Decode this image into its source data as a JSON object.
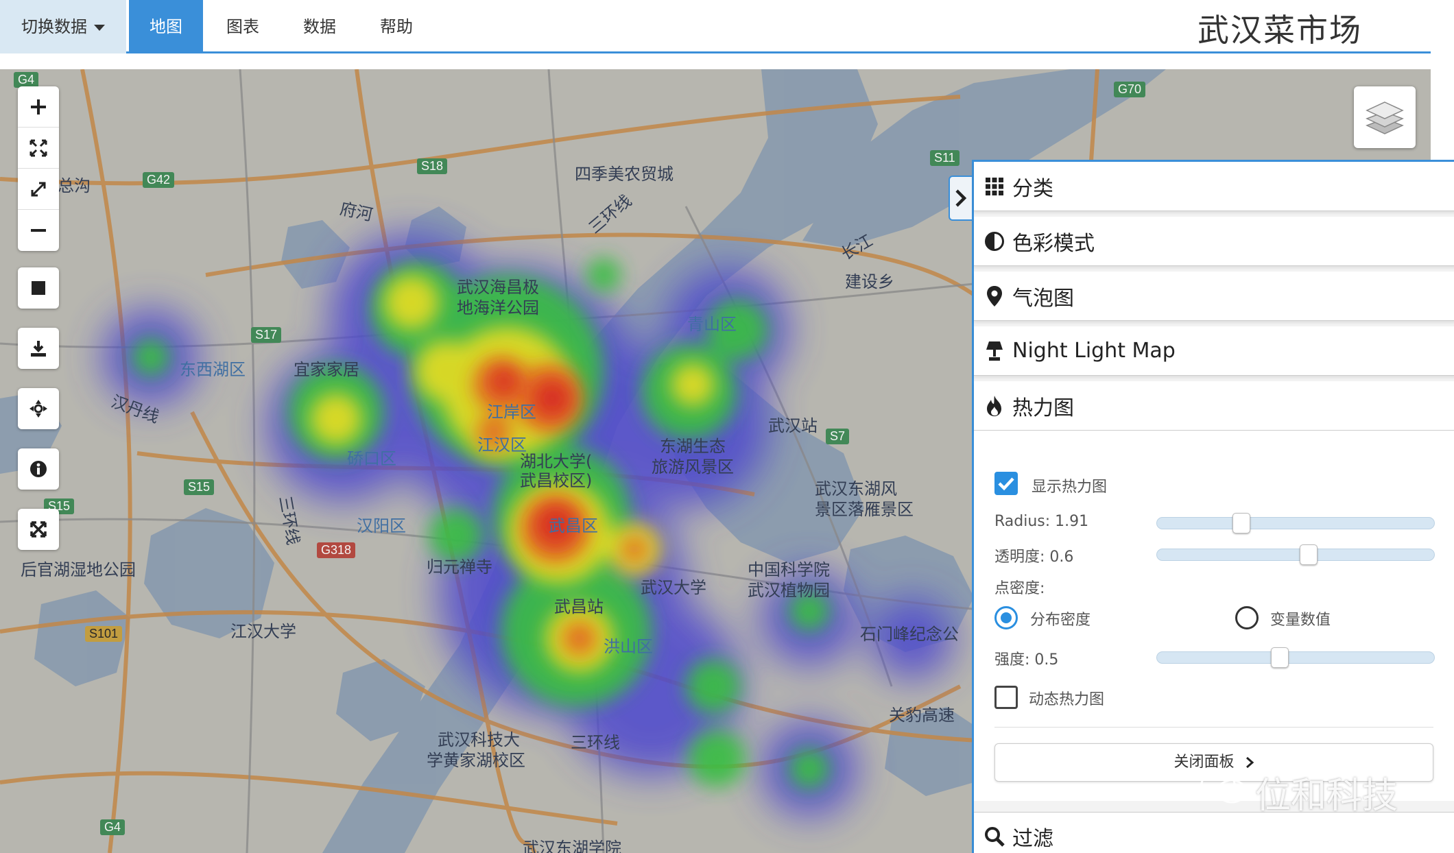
{
  "nav": {
    "switch_label": "切换数据",
    "tabs": [
      "地图",
      "图表",
      "数据",
      "帮助"
    ],
    "title": "武汉菜市场"
  },
  "map": {
    "labels": [
      {
        "text": "四季美农贸城",
        "blue": false
      },
      {
        "text": "武汉海昌极",
        "blue": false
      },
      {
        "text": "地海洋公园",
        "blue": false
      },
      {
        "text": "青山区",
        "blue": true
      },
      {
        "text": "东西湖区",
        "blue": true
      },
      {
        "text": "宜家家居",
        "blue": false
      },
      {
        "text": "硚口区",
        "blue": true
      },
      {
        "text": "江岸区",
        "blue": true
      },
      {
        "text": "江汉区",
        "blue": true
      },
      {
        "text": "湖北大学(",
        "blue": false
      },
      {
        "text": "武昌校区)",
        "blue": false
      },
      {
        "text": "东湖生态",
        "blue": false
      },
      {
        "text": "旅游风景区",
        "blue": false
      },
      {
        "text": "武汉站",
        "blue": false
      },
      {
        "text": "武汉东湖风",
        "blue": false
      },
      {
        "text": "景区落雁景区",
        "blue": false
      },
      {
        "text": "汉阳区",
        "blue": true
      },
      {
        "text": "武昌区",
        "blue": true
      },
      {
        "text": "归元禅寺",
        "blue": false
      },
      {
        "text": "武汉大学",
        "blue": false
      },
      {
        "text": "中国科学院",
        "blue": false
      },
      {
        "text": "武汉植物园",
        "blue": false
      },
      {
        "text": "武昌站",
        "blue": false
      },
      {
        "text": "洪山区",
        "blue": true
      },
      {
        "text": "后官湖湿地公园",
        "blue": false
      },
      {
        "text": "江汉大学",
        "blue": false
      },
      {
        "text": "石门峰纪念公",
        "blue": false
      },
      {
        "text": "武汉科技大",
        "blue": false
      },
      {
        "text": "学黄家湖校区",
        "blue": false
      },
      {
        "text": "三环线",
        "blue": false
      },
      {
        "text": "关豹高速",
        "blue": false
      },
      {
        "text": "府河",
        "blue": false
      },
      {
        "text": "总沟",
        "blue": false
      },
      {
        "text": "汉丹线",
        "blue": false
      },
      {
        "text": "长江",
        "blue": false
      },
      {
        "text": "建设乡",
        "blue": false
      },
      {
        "text": "三环线",
        "blue": false
      },
      {
        "text": "三环线",
        "blue": false
      },
      {
        "text": "武汉东湖学院",
        "blue": false
      }
    ],
    "shields": [
      "G4",
      "G42",
      "S18",
      "G70",
      "S17",
      "S15",
      "G318",
      "S101",
      "S7",
      "G4",
      "S11",
      "S15"
    ]
  },
  "controls": {
    "icons": [
      "zoom-in-icon",
      "zoom-extent-icon",
      "fullscreen-icon",
      "zoom-out-icon",
      "draw-square-icon",
      "download-icon",
      "locate-icon",
      "info-icon",
      "expand-icon"
    ]
  },
  "panel": {
    "sections": {
      "category": "分类",
      "color_mode": "色彩模式",
      "bubble": "气泡图",
      "night_light": "Night Light Map",
      "heatmap": "热力图",
      "filter": "过滤"
    },
    "heat": {
      "show_label": "显示热力图",
      "show_checked": true,
      "radius_label": "Radius: 1.91",
      "radius_value": 0.29,
      "opacity_label": "透明度: 0.6",
      "opacity_value": 0.55,
      "density_label": "点密度:",
      "radio_distribution": "分布密度",
      "radio_variable": "变量数值",
      "selected": "distribution",
      "intensity_label": "强度: 0.5",
      "intensity_value": 0.44,
      "dynamic_label": "动态热力图",
      "dynamic_checked": false,
      "close_label": "关闭面板"
    }
  },
  "watermark": "位和科技",
  "colors": {
    "accent": "#3a8fd9",
    "heat_hot": "#e02a1e",
    "heat_warm": "#f2e51a",
    "heat_mid": "#36c63c",
    "heat_cool": "#4b44d6"
  }
}
